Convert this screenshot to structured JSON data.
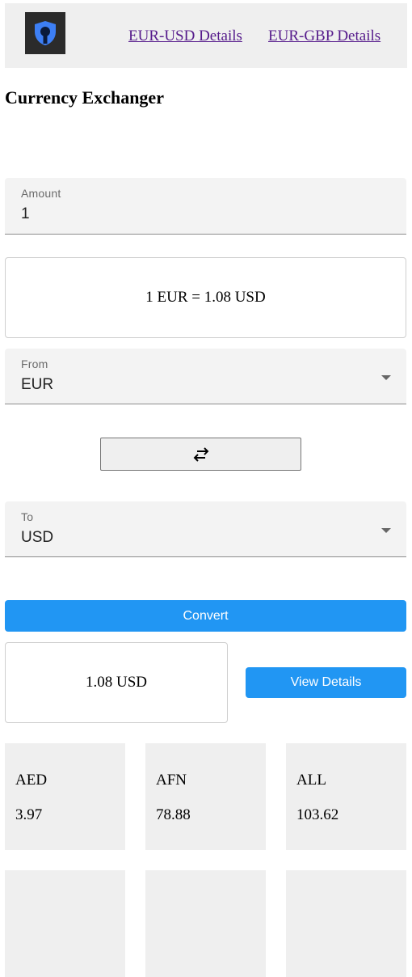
{
  "header": {
    "nav_links": [
      "EUR-USD Details",
      "EUR-GBP Details"
    ]
  },
  "title": "Currency Exchanger",
  "amount": {
    "label": "Amount",
    "value": "1"
  },
  "rate_text": "1 EUR = 1.08 USD",
  "from": {
    "label": "From",
    "value": "EUR"
  },
  "to": {
    "label": "To",
    "value": "USD"
  },
  "convert_label": "Convert",
  "result_text": "1.08 USD",
  "view_details_label": "View Details",
  "cards": [
    {
      "code": "AED",
      "rate": "3.97"
    },
    {
      "code": "AFN",
      "rate": "78.88"
    },
    {
      "code": "ALL",
      "rate": "103.62"
    },
    {
      "code": "",
      "rate": ""
    },
    {
      "code": "",
      "rate": ""
    },
    {
      "code": "",
      "rate": ""
    }
  ],
  "colors": {
    "accent": "#2196f3",
    "link": "#551a8b",
    "panel": "#efefef"
  },
  "icons": {
    "logo": "shield-keyhole-icon",
    "swap": "swap-arrows-icon",
    "dropdown": "caret-down-icon"
  }
}
